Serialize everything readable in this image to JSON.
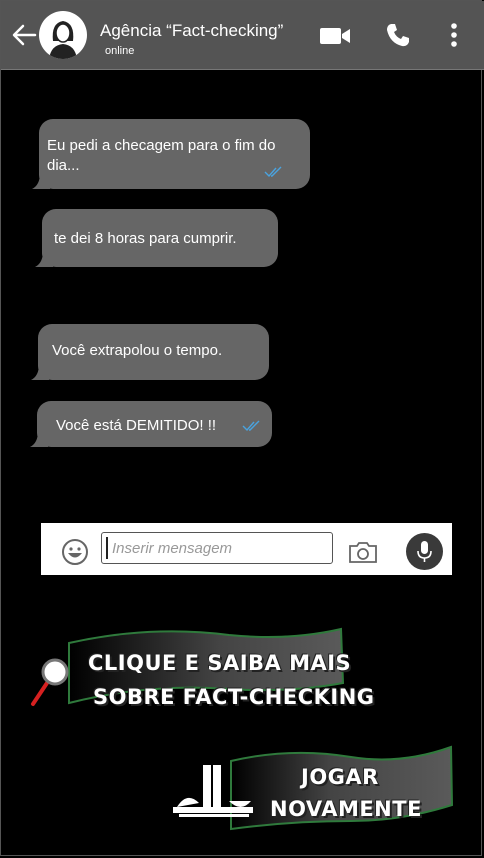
{
  "header": {
    "contact_name": "Agência “Fact-checking”",
    "status": "online"
  },
  "messages": [
    {
      "text": "Eu pedi a checagem para o fim do dia...",
      "read": true
    },
    {
      "text": "te dei 8 horas para cumprir.",
      "read": false
    },
    {
      "text": "Você extrapolou o tempo.",
      "read": false
    },
    {
      "text": "Você está DEMITIDO! !!",
      "read": true
    }
  ],
  "composer": {
    "placeholder": "Inserir mensagem"
  },
  "actions": {
    "learn_more_line1": "Clique e saiba mais",
    "learn_more_line2": "sobre fact-checking",
    "play_again_line1": "Jogar",
    "play_again_line2": "novamente"
  },
  "colors": {
    "header_bg": "#545454",
    "bubble_bg": "#666666",
    "check_blue": "#4aa3df",
    "banner_green": "#2f7a3c",
    "search_red": "#d62020"
  }
}
